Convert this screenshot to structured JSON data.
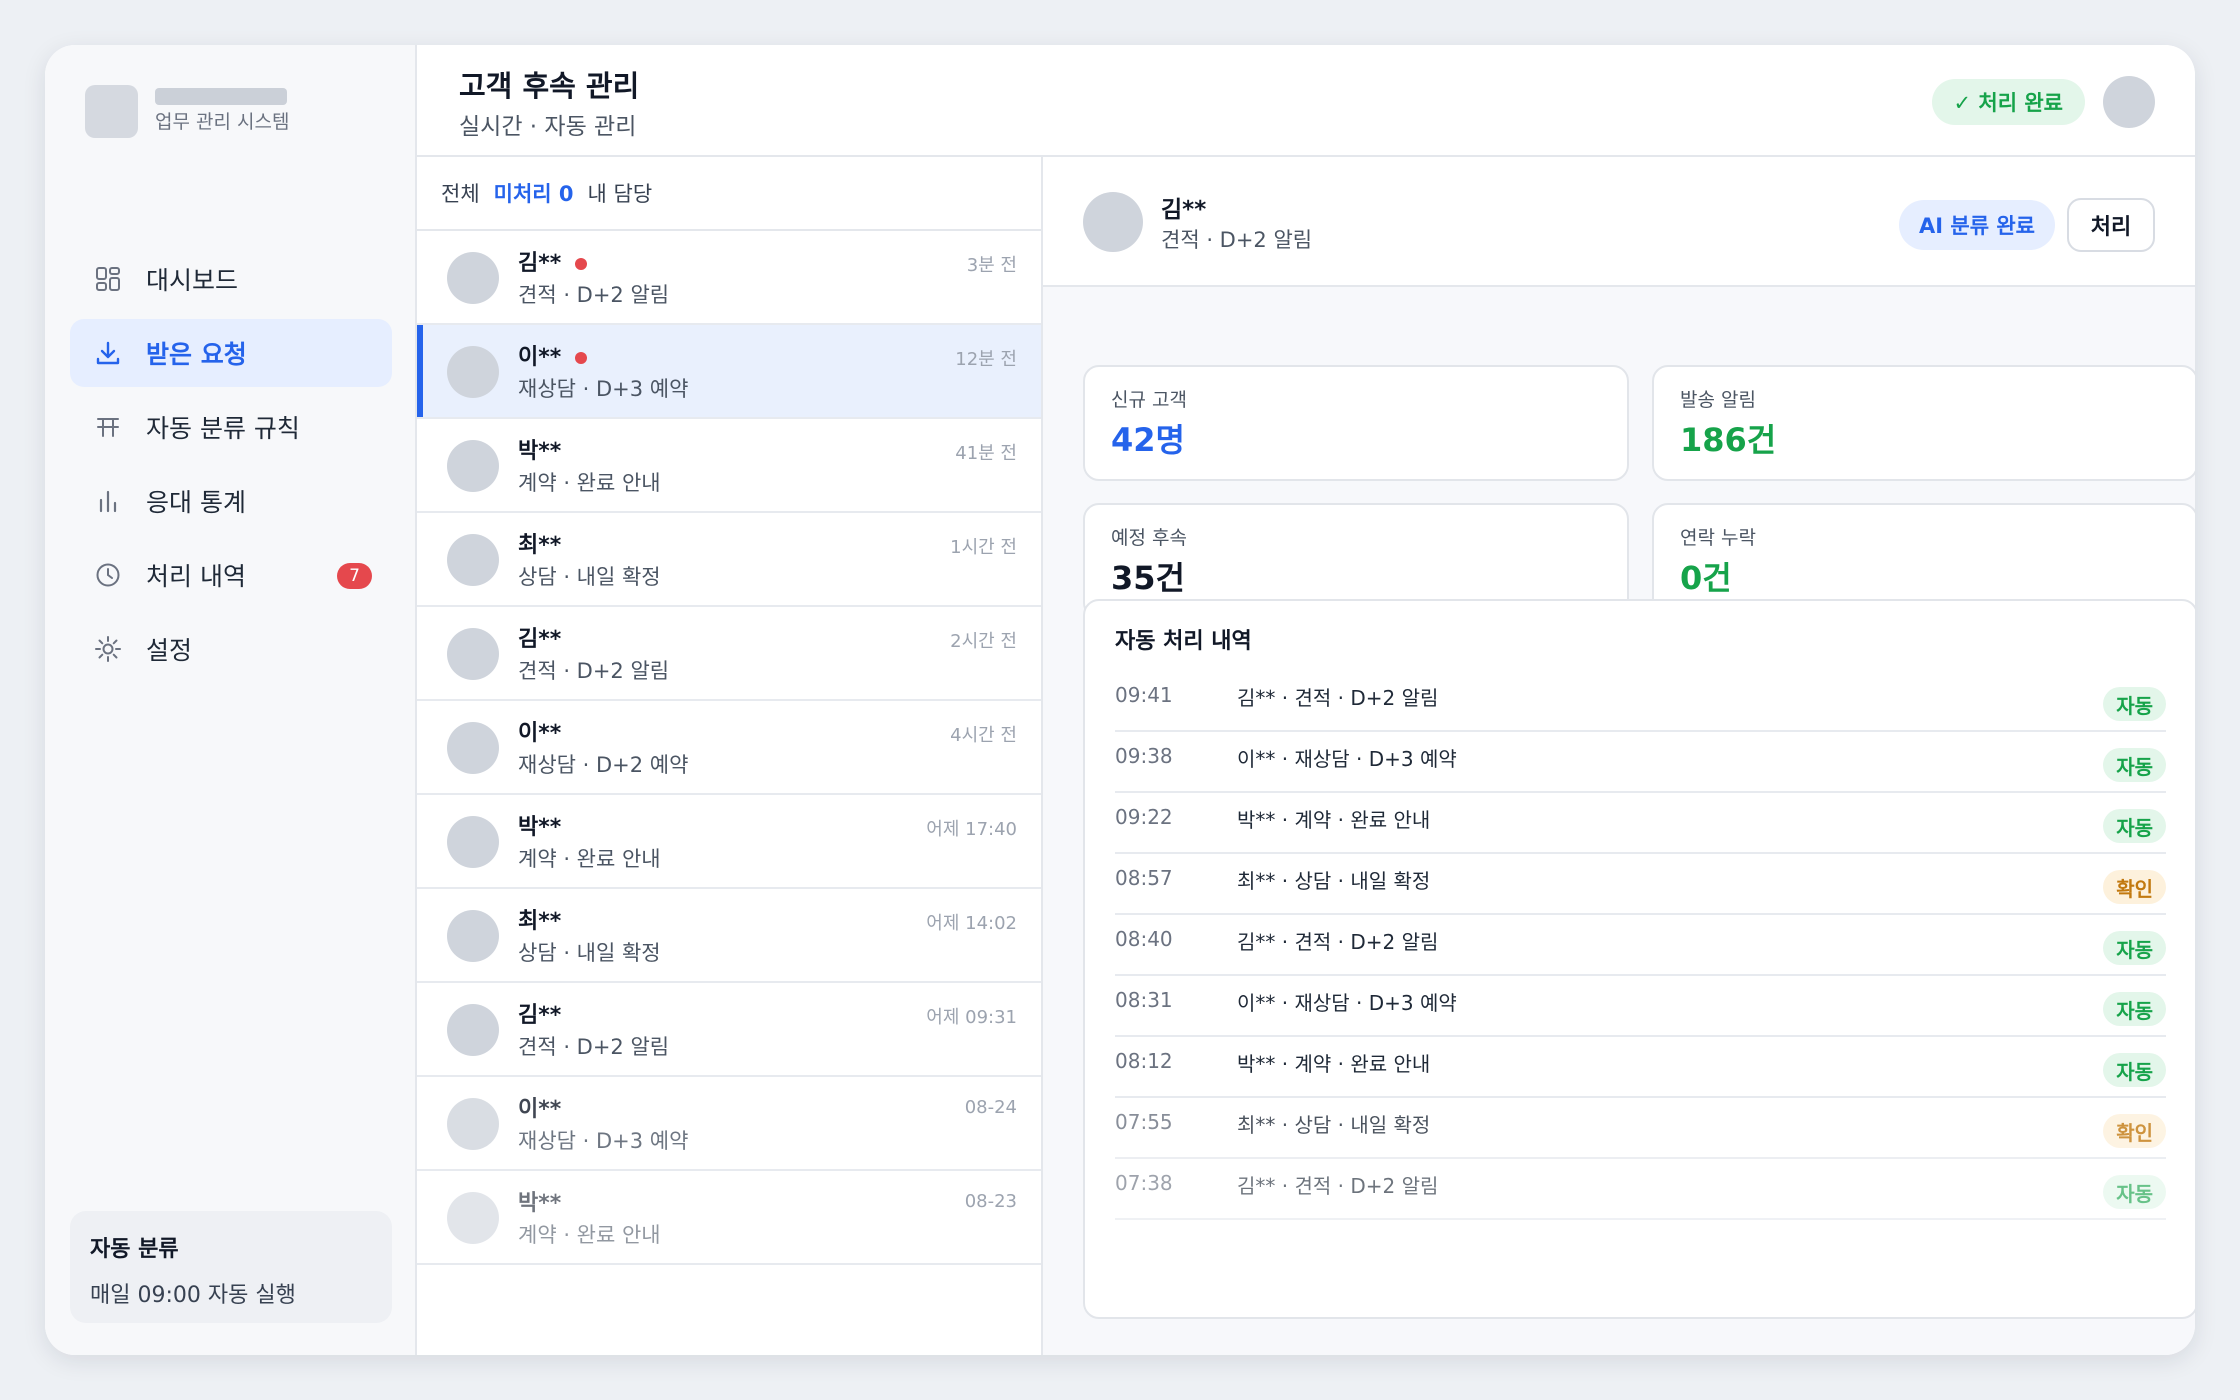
{
  "brand": {
    "subtitle": "업무 관리 시스템"
  },
  "sidebar": {
    "items": [
      {
        "label": "대시보드",
        "icon": "dashboard-icon"
      },
      {
        "label": "받은 요청",
        "icon": "download-icon",
        "active": true
      },
      {
        "label": "자동 분류 규칙",
        "icon": "rule-icon"
      },
      {
        "label": "응대 통계",
        "icon": "bar-chart-icon"
      },
      {
        "label": "처리 내역",
        "icon": "clock-icon",
        "badge": "7"
      },
      {
        "label": "설정",
        "icon": "gear-icon"
      }
    ],
    "auto": {
      "title": "자동 분류",
      "schedule": "매일 09:00 자동 실행"
    }
  },
  "header": {
    "title": "고객 후속 관리",
    "subtitle": "실시간 · 자동 관리",
    "status_badge": "✓ 처리 완료"
  },
  "list": {
    "tabs": [
      "전체",
      "미처리 0",
      "내 담당"
    ],
    "rows": [
      {
        "name": "김**",
        "sub": "견적 · D+2 알림",
        "time": "3분 전",
        "unread": true
      },
      {
        "name": "이**",
        "sub": "재상담 · D+3 예약",
        "time": "12분 전",
        "unread": true
      },
      {
        "name": "박**",
        "sub": "계약 · 완료 안내",
        "time": "41분 전"
      },
      {
        "name": "최**",
        "sub": "상담 · 내일 확정",
        "time": "1시간 전"
      },
      {
        "name": "김**",
        "sub": "견적 · D+2 알림",
        "time": "2시간 전"
      },
      {
        "name": "이**",
        "sub": "재상담 · D+2 예약",
        "time": "4시간 전"
      },
      {
        "name": "박**",
        "sub": "계약 · 완료 안내",
        "time": "어제 17:40"
      },
      {
        "name": "최**",
        "sub": "상담 · 내일 확정",
        "time": "어제 14:02"
      },
      {
        "name": "김**",
        "sub": "견적 · D+2 알림",
        "time": "어제 09:31"
      },
      {
        "name": "이**",
        "sub": "재상담 · D+3 예약",
        "time": "08-24"
      },
      {
        "name": "박**",
        "sub": "계약 · 완료 안내",
        "time": "08-23"
      }
    ]
  },
  "detail": {
    "name": "김**",
    "sub": "견적 · D+2 알림",
    "ai_badge": "AI 분류 완료",
    "process_button": "처리",
    "stats": [
      {
        "label": "신규 고객",
        "value": "42명",
        "color": "#2563eb"
      },
      {
        "label": "발송 알림",
        "value": "186건",
        "color": "#16a34a"
      },
      {
        "label": "예정 후속",
        "value": "35건",
        "color": "#111827"
      },
      {
        "label": "연락 누락",
        "value": "0건",
        "color": "#16a34a"
      }
    ],
    "log_title": "자동 처리 내역",
    "log": [
      {
        "time": "09:41",
        "desc": "김** · 견적 · D+2 알림",
        "status": "자동"
      },
      {
        "time": "09:38",
        "desc": "이** · 재상담 · D+3 예약",
        "status": "자동"
      },
      {
        "time": "09:22",
        "desc": "박** · 계약 · 완료 안내",
        "status": "자동"
      },
      {
        "time": "08:57",
        "desc": "최** · 상담 · 내일 확정",
        "status": "확인"
      },
      {
        "time": "08:40",
        "desc": "김** · 견적 · D+2 알림",
        "status": "자동"
      },
      {
        "time": "08:31",
        "desc": "이** · 재상담 · D+3 예약",
        "status": "자동"
      },
      {
        "time": "08:12",
        "desc": "박** · 계약 · 완료 안내",
        "status": "자동"
      },
      {
        "time": "07:55",
        "desc": "최** · 상담 · 내일 확정",
        "status": "확인"
      },
      {
        "time": "07:38",
        "desc": "김** · 견적 · D+2 알림",
        "status": "자동"
      }
    ]
  }
}
